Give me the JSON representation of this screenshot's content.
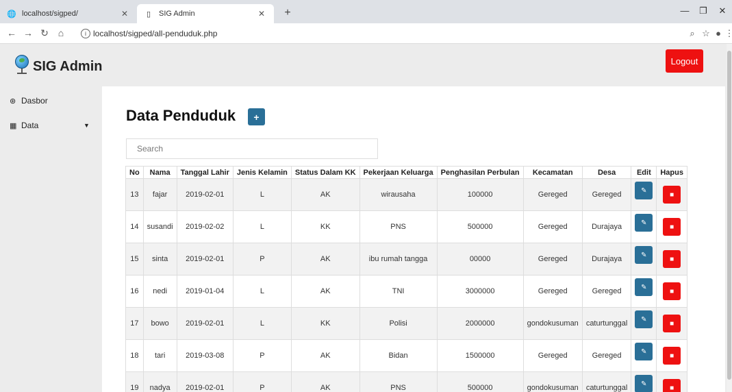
{
  "browser": {
    "tabs": [
      {
        "title": "localhost/sigped/"
      },
      {
        "title": "SIG Admin"
      }
    ],
    "url": "localhost/sigped/all-penduduk.php"
  },
  "app": {
    "brand": "SIG Admin",
    "logout_label": "Logout"
  },
  "sidebar": {
    "items": [
      {
        "label": "Dasbor",
        "icon": "dashboard-icon"
      },
      {
        "label": "Data",
        "icon": "table-icon"
      }
    ]
  },
  "main": {
    "title": "Data Penduduk",
    "add_label": "+",
    "search_placeholder": "Search",
    "columns": [
      "No",
      "Nama",
      "Tanggal Lahir",
      "Jenis Kelamin",
      "Status Dalam KK",
      "Pekerjaan Keluarga",
      "Penghasilan Perbulan",
      "Kecamatan",
      "Desa",
      "Edit",
      "Hapus"
    ],
    "rows": [
      {
        "no": "13",
        "nama": "fajar",
        "tgl": "2019-02-01",
        "jk": "L",
        "status": "AK",
        "pekerjaan": "wirausaha",
        "penghasilan": "100000",
        "kecamatan": "Gereged",
        "desa": "Gereged"
      },
      {
        "no": "14",
        "nama": "susandi",
        "tgl": "2019-02-02",
        "jk": "L",
        "status": "KK",
        "pekerjaan": "PNS",
        "penghasilan": "500000",
        "kecamatan": "Gereged",
        "desa": "Durajaya"
      },
      {
        "no": "15",
        "nama": "sinta",
        "tgl": "2019-02-01",
        "jk": "P",
        "status": "AK",
        "pekerjaan": "ibu rumah tangga",
        "penghasilan": "00000",
        "kecamatan": "Gereged",
        "desa": "Durajaya"
      },
      {
        "no": "16",
        "nama": "nedi",
        "tgl": "2019-01-04",
        "jk": "L",
        "status": "AK",
        "pekerjaan": "TNI",
        "penghasilan": "3000000",
        "kecamatan": "Gereged",
        "desa": "Gereged"
      },
      {
        "no": "17",
        "nama": "bowo",
        "tgl": "2019-02-01",
        "jk": "L",
        "status": "KK",
        "pekerjaan": "Polisi",
        "penghasilan": "2000000",
        "kecamatan": "gondokusuman",
        "desa": "caturtunggal"
      },
      {
        "no": "18",
        "nama": "tari",
        "tgl": "2019-03-08",
        "jk": "P",
        "status": "AK",
        "pekerjaan": "Bidan",
        "penghasilan": "1500000",
        "kecamatan": "Gereged",
        "desa": "Gereged"
      },
      {
        "no": "19",
        "nama": "nadya",
        "tgl": "2019-02-01",
        "jk": "P",
        "status": "AK",
        "pekerjaan": "PNS",
        "penghasilan": "500000",
        "kecamatan": "gondokusuman",
        "desa": "caturtunggal"
      }
    ]
  },
  "colors": {
    "primary": "#2a6f97",
    "danger": "#ee1111",
    "chrome_tabbar": "#dee1e6",
    "app_bg": "#ececec"
  }
}
